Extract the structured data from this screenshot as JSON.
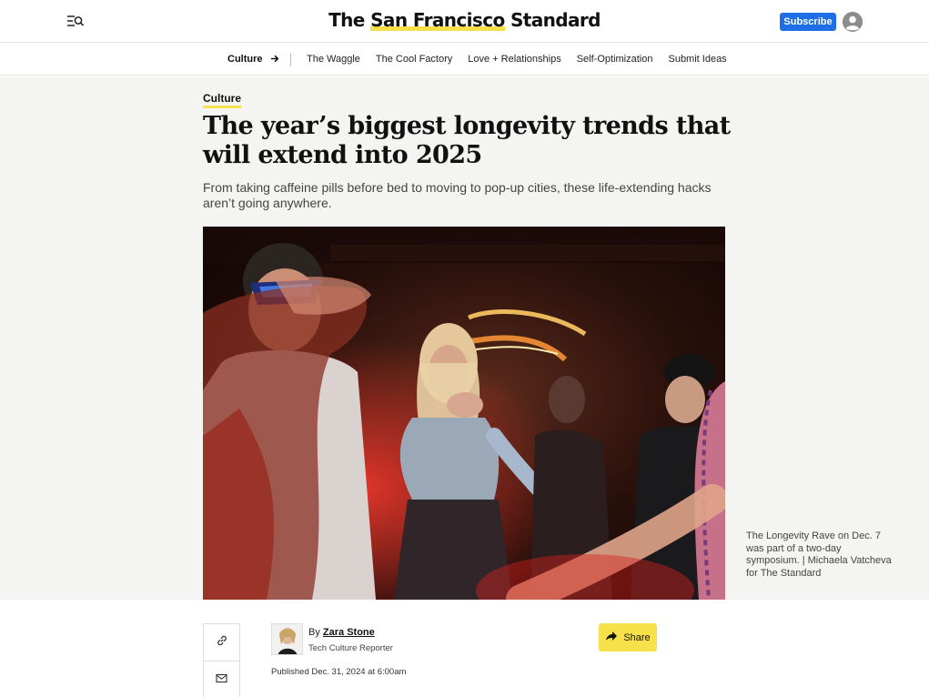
{
  "header": {
    "logo_prefix": "The ",
    "logo_highlight": "San Francisco",
    "logo_suffix": " Standard",
    "subscribe_label": "Subscribe",
    "accent_color": "#1e6fe6",
    "highlight_color": "#f6e14a"
  },
  "subnav": {
    "section_label": "Culture",
    "links": [
      "The Waggle",
      "The Cool Factory",
      "Love + Relationships",
      "Self-Optimization",
      "Submit Ideas"
    ]
  },
  "article": {
    "category": "Culture",
    "headline": "The year’s biggest longevity trends that will extend into 2025",
    "dek": "From taking caffeine pills before bed to moving to pop-up cities, these life-extending hacks aren’t going anywhere.",
    "caption": "The Longevity Rave on Dec. 7 was part of a two-day symposium. | Michaela Vatcheva for The Standard",
    "byline_prefix": "By",
    "author_name": "Zara Stone",
    "author_role": "Tech Culture Reporter",
    "published": "Published Dec. 31, 2024 at 6:00am",
    "share_label": "Share"
  },
  "icons": {
    "menu": "menu-search-icon",
    "account": "user-icon",
    "arrow": "arrow-right-icon",
    "link": "link-icon",
    "email": "mail-icon",
    "share": "share-arrow-icon"
  }
}
